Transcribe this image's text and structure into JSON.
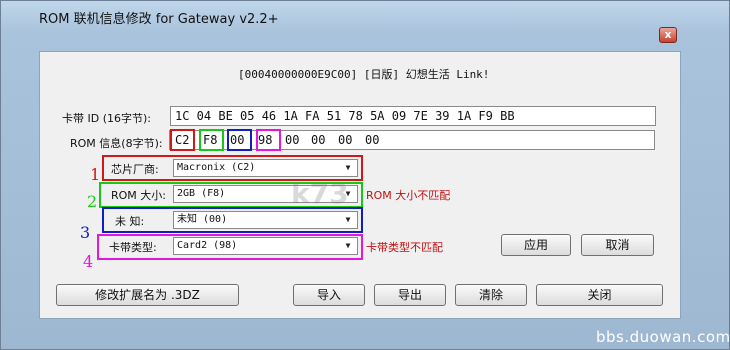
{
  "window": {
    "title": "ROM 联机信息修改 for Gateway v2.2+",
    "close_glyph": "x",
    "icon_name": "close-icon"
  },
  "header": {
    "game_line": "[00040000000E9C00] [日版] 幻想生活 Link!"
  },
  "card_id": {
    "label": "卡带 ID (16字节):",
    "value": "1C 04 BE 05 46 1A FA 51 78 5A 09 7E 39 1A F9 BB"
  },
  "rom_info": {
    "label": "ROM 信息(8字节):",
    "bytes": [
      "C2",
      "F8",
      "00",
      "98",
      "00",
      "00",
      "00",
      "00"
    ]
  },
  "fields": [
    {
      "number": "1",
      "label": "芯片厂商:",
      "value": "Macronix (C2)",
      "warning": "",
      "color": "#d01818"
    },
    {
      "number": "2",
      "label": "ROM 大小:",
      "value": "2GB (F8)",
      "warning": "ROM 大小不匹配",
      "color": "#18c818"
    },
    {
      "number": "3",
      "label": "未  知:",
      "value": "未知 (00)",
      "warning": "",
      "color": "#1020c0"
    },
    {
      "number": "4",
      "label": "卡带类型:",
      "value": "Card2 (98)",
      "warning": "卡带类型不匹配",
      "color": "#e018e0"
    }
  ],
  "buttons": {
    "apply": "应用",
    "cancel": "取消",
    "rename": "修改扩展名为 .3DZ",
    "import": "导入",
    "export": "导出",
    "clear": "清除",
    "close": "关闭"
  },
  "watermarks": {
    "k73": "k73",
    "site": "bbs.duowan.com"
  },
  "colors": {
    "title_bar": "#a9c3dc",
    "warning_text": "#c01010",
    "client_bg": "#f0f0f0"
  }
}
